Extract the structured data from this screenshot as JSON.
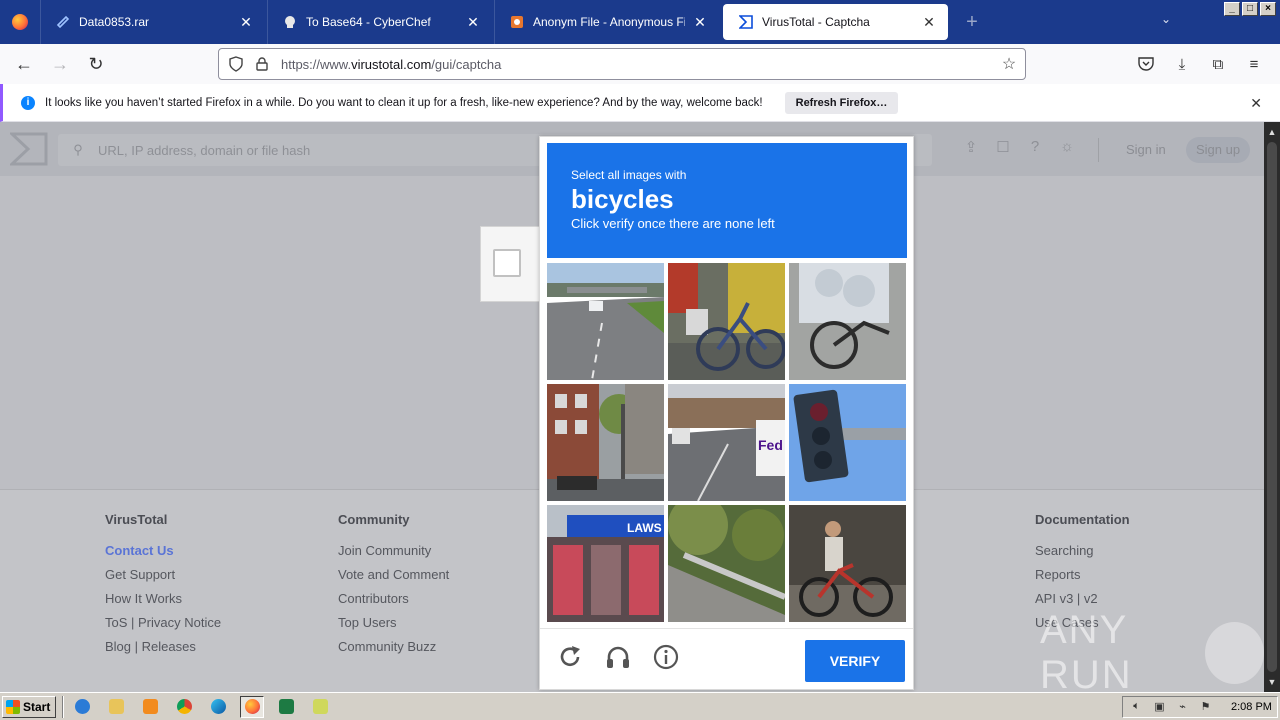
{
  "browser": {
    "tabs": [
      {
        "label": "Data0853.rar",
        "icon": "file-icon"
      },
      {
        "label": "To Base64 - CyberChef",
        "icon": "chef-hat-icon"
      },
      {
        "label": "Anonym File - Anonymous File Uplo",
        "icon": "upload-site-icon"
      },
      {
        "label": "VirusTotal - Captcha",
        "icon": "virustotal-icon"
      }
    ],
    "active_tab": 3,
    "url_prefix": "https://www.",
    "url_domain": "virustotal.com",
    "url_path": "/gui/captcha"
  },
  "notification": {
    "text": "It looks like you haven’t started Firefox in a while. Do you want to clean it up for a fresh, like-new experience? And by the way, welcome back!",
    "button": "Refresh Firefox…"
  },
  "virustotal": {
    "search_placeholder": "URL, IP address, domain or file hash",
    "sign_in": "Sign in",
    "sign_up": "Sign up"
  },
  "captcha": {
    "line1": "Select all images with",
    "object": "bicycles",
    "line3": "Click verify once there are none left",
    "verify": "VERIFY",
    "tiles": [
      "highway",
      "bicycle-wall",
      "bicycle-cargo",
      "street-building",
      "street-van",
      "traffic-light",
      "store-front",
      "road-guardrail",
      "person-bicycle"
    ]
  },
  "footer": {
    "columns": [
      {
        "heading": "VirusTotal",
        "links": [
          "Contact Us",
          "Get Support",
          "How It Works",
          "ToS | Privacy Notice",
          "Blog | Releases"
        ]
      },
      {
        "heading": "Community",
        "links": [
          "Join Community",
          "Vote and Comment",
          "Contributors",
          "Top Users",
          "Community Buzz"
        ]
      },
      {
        "heading": "Documentation",
        "links": [
          "Searching",
          "Reports",
          "API v3 | v2",
          "Use Cases"
        ]
      }
    ]
  },
  "watermark": "ANY RUN",
  "taskbar": {
    "start": "Start",
    "clock": "2:08 PM"
  },
  "colors": {
    "accent": "#1a73e8",
    "tabstrip": "#1b3a8c",
    "notify_accent": "#9059ff"
  }
}
